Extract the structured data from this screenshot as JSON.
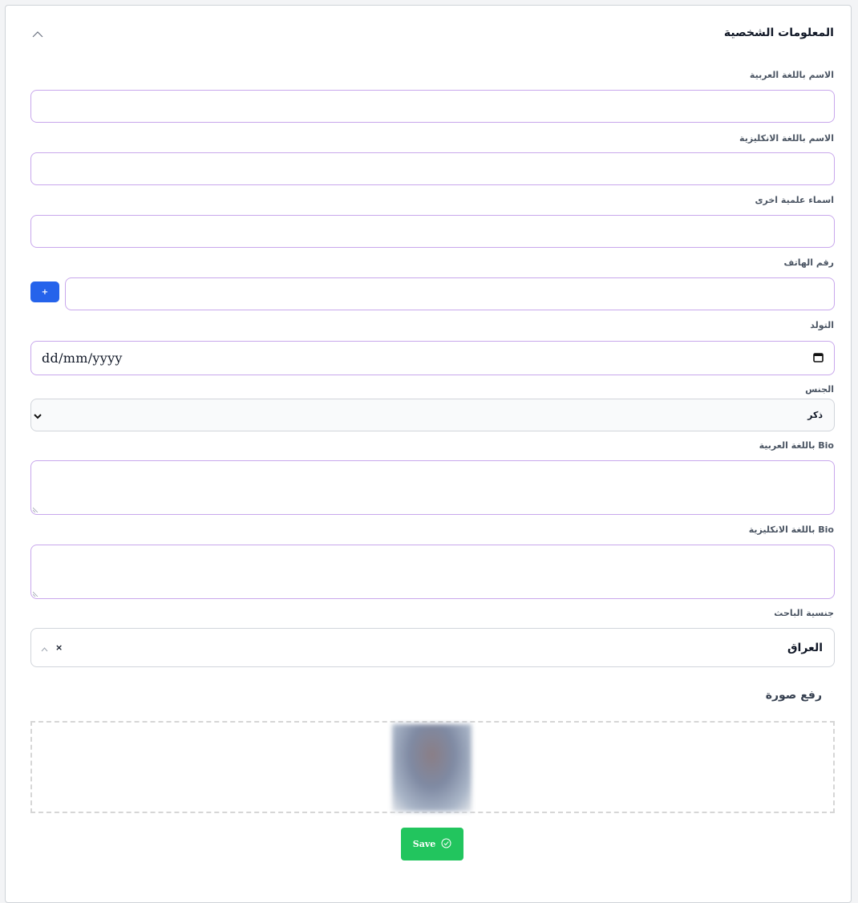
{
  "section": {
    "title": "المعلومات الشخصية",
    "collapse_icon": "chevron-up-icon"
  },
  "fields": {
    "name_ar": {
      "label": "الاسم باللغة العربية",
      "value": ""
    },
    "name_en": {
      "label": "الاسم باللغة الانكليزية",
      "value": ""
    },
    "other_names": {
      "label": "اسماء علمية اخرى",
      "value": ""
    },
    "phone": {
      "label": "رقم الهاتف",
      "value": "",
      "add_button": "+"
    },
    "birth": {
      "label": "التولد",
      "placeholder": "dd/mm/yyyy",
      "icon": "calendar-icon"
    },
    "gender": {
      "label": "الجنس",
      "selected": "ذكر"
    },
    "bio_ar": {
      "label": "Bio باللغة العربية",
      "value": ""
    },
    "bio_en": {
      "label": "Bio باللغة الانكليزية",
      "value": ""
    },
    "nationality": {
      "label": "جنسية الباحث",
      "selected": "العراق",
      "clear": "×"
    }
  },
  "upload": {
    "title": "رفع صورة"
  },
  "actions": {
    "save_label": "Save",
    "save_color": "#22c55e"
  },
  "colors": {
    "input_border": "#c8a7ec",
    "add_button": "#2563eb"
  }
}
